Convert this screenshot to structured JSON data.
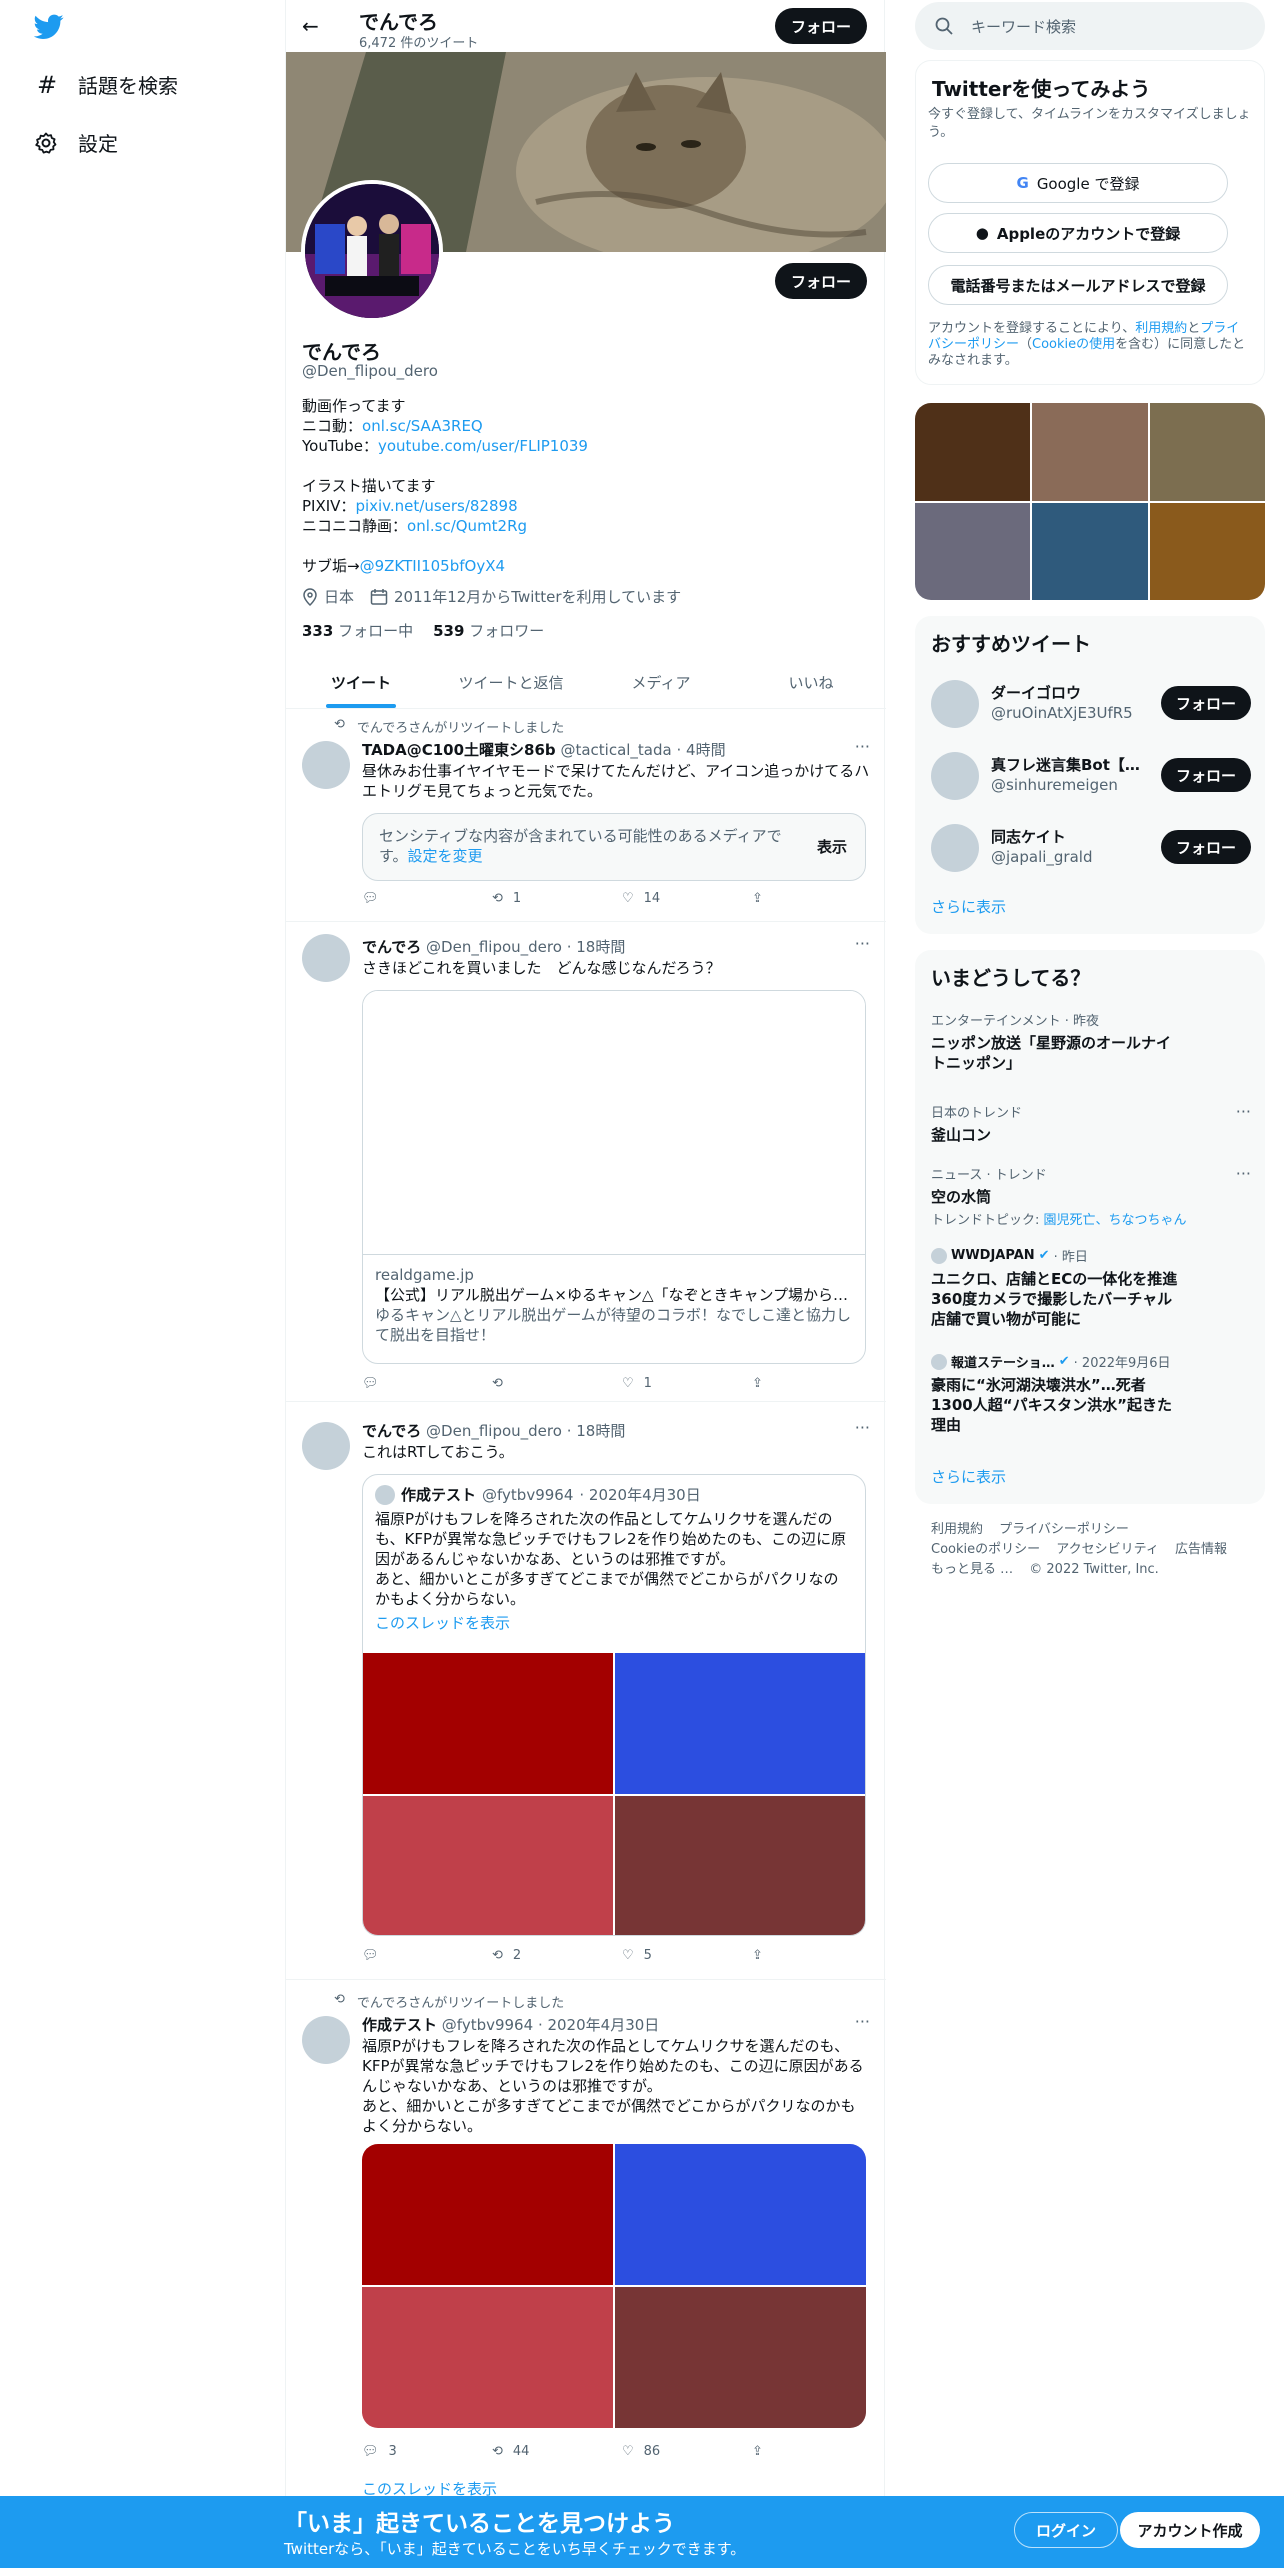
{
  "left_nav": {
    "explore_label": "話題を検索",
    "settings_label": "設定"
  },
  "topbar": {
    "title": "でんでろ",
    "tweet_count": "6,472 件のツイート",
    "follow_label": "フォロー"
  },
  "profile": {
    "name": "でんでろ",
    "handle": "@Den_flipou_dero",
    "follow_label": "フォロー",
    "bio": {
      "line1": "動画作ってます",
      "nico_label": "ニコ動：",
      "nico_link": "onl.sc/SAA3REQ",
      "yt_label": "YouTube：",
      "yt_link": "youtube.com/user/FLIP1039",
      "line4": "イラスト描いてます",
      "pixiv_label": "PIXIV：",
      "pixiv_link": "pixiv.net/users/82898",
      "seiga_label": "ニコニコ静画：",
      "seiga_link": "onl.sc/Qumt2Rg",
      "sub_label": "サブ垢→",
      "sub_link": "@9ZKTII105bfOyX4"
    },
    "location": "日本",
    "joined": "2011年12月からTwitterを利用しています",
    "following_count": "333",
    "following_label": "フォロー中",
    "followers_count": "539",
    "followers_label": "フォロワー"
  },
  "tabs": [
    "ツイート",
    "ツイートと返信",
    "メディア",
    "いいね"
  ],
  "tweets": [
    {
      "retweet_by": "でんでろさんがリツイートしました",
      "name": "TADA@C100土曜東シ86b",
      "handle": "@tactical_tada",
      "time": "· 4時間",
      "text": "昼休みお仕事イヤイヤモードで呆けてたんだけど、アイコン追っかけてるハエトリグモ見てちょっと元気でた。",
      "sensitive_text": "センシティブな内容が含まれている可能性のあるメディアです。",
      "sensitive_link": "設定を変更",
      "sensitive_show": "表示",
      "replies": "",
      "retweets": "1",
      "likes": "14"
    },
    {
      "name": "でんでろ",
      "handle": "@Den_flipou_dero",
      "time": "· 18時間",
      "text": "さきほどこれを買いました　どんな感じなんだろう？",
      "card_domain": "realdgame.jp",
      "card_title": "【公式】リアル脱出ゲーム×ゆるキャン△「なぞときキャンプ場から…",
      "card_desc": "ゆるキャン△とリアル脱出ゲームが待望のコラボ！なでしこ達と協力して脱出を目指せ！",
      "replies": "",
      "retweets": "",
      "likes": "1"
    },
    {
      "name": "でんでろ",
      "handle": "@Den_flipou_dero",
      "time": "· 18時間",
      "text": "これはRTしておこう。",
      "quote_name": "作成テスト",
      "quote_handle": "@fytbv9964",
      "quote_time": "· 2020年4月30日",
      "quote_text": "福原Pがけもフレを降ろされた次の作品としてケムリクサを選んだのも、KFPが異常な急ピッチでけもフレ2を作り始めたのも、この辺に原因があるんじゃないかなあ、というのは邪推ですが。\nあと、細かいとこが多すぎてどこまでが偶然でどこからがパクリなのかもよく分からない。",
      "quote_thread": "このスレッドを表示",
      "replies": "",
      "retweets": "2",
      "likes": "5"
    },
    {
      "retweet_by": "でんでろさんがリツイートしました",
      "name": "作成テスト",
      "handle": "@fytbv9964",
      "time": "· 2020年4月30日",
      "text": "福原Pがけもフレを降ろされた次の作品としてケムリクサを選んだのも、KFPが異常な急ピッチでけもフレ2を作り始めたのも、この辺に原因があるんじゃないかなあ、というのは邪推ですが。\nあと、細かいとこが多すぎてどこまでが偶然でどこからがパクリなのかもよく分からない。",
      "replies": "3",
      "retweets": "44",
      "likes": "86",
      "thread_label": "このスレッドを表示"
    }
  ],
  "grid_colors": [
    "#a30000",
    "#2c4ee0",
    "#c0404a",
    "#773535"
  ],
  "media_colors": [
    "#4f3018",
    "#8a6b58",
    "#7c6e50",
    "#6b6a7c",
    "#2f5a7c",
    "#8a5a1c"
  ],
  "right": {
    "search_placeholder": "キーワード検索",
    "signup": {
      "title": "Twitterを使ってみよう",
      "desc": "今すぐ登録して、タイムラインをカスタマイズしましょう。",
      "google": "Google で登録",
      "apple": "Appleのアカウントで登録",
      "phone": "電話番号またはメールアドレスで登録",
      "terms_pre": "アカウントを登録することにより、",
      "terms_link": "利用規約",
      "terms_mid": "と",
      "privacy_link": "プライバシーポリシー",
      "cookie_link": "Cookieの使用",
      "terms_post": "を含む）に同意したとみなされます。"
    },
    "who_title": "おすすめツイート",
    "who": [
      {
        "name": "ダーイゴロウ",
        "handle": "@ruOinAtXjE3UfR5",
        "follow": "フォロー"
      },
      {
        "name": "真フレ迷言集Bot【プ…",
        "handle": "@sinhuremeigen",
        "follow": "フォロー"
      },
      {
        "name": "同志ケイト",
        "handle": "@japali_grald",
        "follow": "フォロー"
      }
    ],
    "who_more": "さらに表示",
    "trends_title": "いまどうしてる？",
    "trends": [
      {
        "ctx": "エンターテインメント · 昨夜",
        "title": "ニッポン放送「星野源のオールナイトニッポン」"
      },
      {
        "ctx": "日本のトレンド",
        "title": "釜山コン"
      },
      {
        "ctx": "ニュース · トレンド",
        "title": "空の水筒",
        "sub_pre": "トレンドトピック: ",
        "sub_link": "園児死亡、ちなつちゃん"
      },
      {
        "ctx_name": "WWDJAPAN",
        "ctx_time": "· 昨日",
        "title": "ユニクロ、店舗とECの一体化を推進　360度カメラで撮影したバーチャル店舗で買い物が可能に"
      },
      {
        "ctx_name": "報道ステーショ…",
        "ctx_time": "· 2022年9月6日",
        "title": "豪雨に“氷河湖決壊洪水”…死者1300人超“パキスタン洪水”起きた理由"
      }
    ],
    "trends_more": "さらに表示",
    "footer": [
      "利用規約",
      "プライバシーポリシー",
      "Cookieのポリシー",
      "アクセシビリティ",
      "広告情報",
      "もっと見る …",
      "© 2022 Twitter, Inc."
    ]
  },
  "bottombar": {
    "title": "「いま」起きていることを見つけよう",
    "sub": "Twitterなら、「いま」起きていることをいち早くチェックできます。",
    "login": "ログイン",
    "signup": "アカウント作成"
  }
}
